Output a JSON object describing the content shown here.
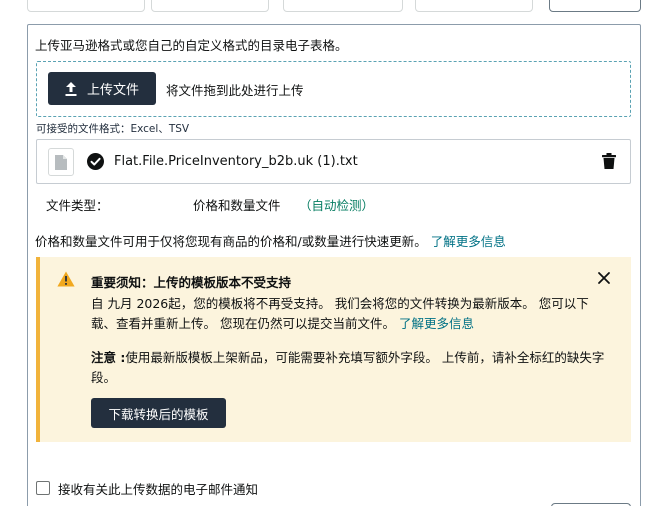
{
  "upload": {
    "intro": "上传亚马逊格式或您自己的自定义格式的目录电子表格。",
    "button_label": "上传文件",
    "drop_hint": "将文件拖到此处进行上传",
    "accepted_formats": "可接受的文件格式：Excel、TSV"
  },
  "file": {
    "name": "Flat.File.PriceInventory_b2b.uk (1).txt"
  },
  "file_type": {
    "label": "文件类型：",
    "value": "价格和数量文件",
    "auto_detected": "（自动检测）"
  },
  "info": {
    "text": "价格和数量文件可用于仅将您现有商品的价格和/或数量进行快速更新。",
    "link": "了解更多信息"
  },
  "alert": {
    "title": "重要须知：上传的模板版本不受支持",
    "body": "自 九月 2026起，您的模板将不再受支持。 我们会将您的文件转换为最新版本。 您可以下载、查看并重新上传。 您现在仍然可以提交当前文件。",
    "body_link": "了解更多信息",
    "note_label": "注意 :",
    "note_text": "使用最新版模板上架新品，可能需要补充填写额外字段。 上传前，请补全标红的缺失字段。",
    "download_button": "下载转换后的模板"
  },
  "email_notify": {
    "label": "接收有关此上传数据的电子邮件通知",
    "checked": false
  },
  "colors": {
    "dark_button": "#232f3e",
    "link": "#007185",
    "auto_detect": "#067d62",
    "alert_bg": "#fcf4dd",
    "alert_border": "#f1b33b"
  }
}
